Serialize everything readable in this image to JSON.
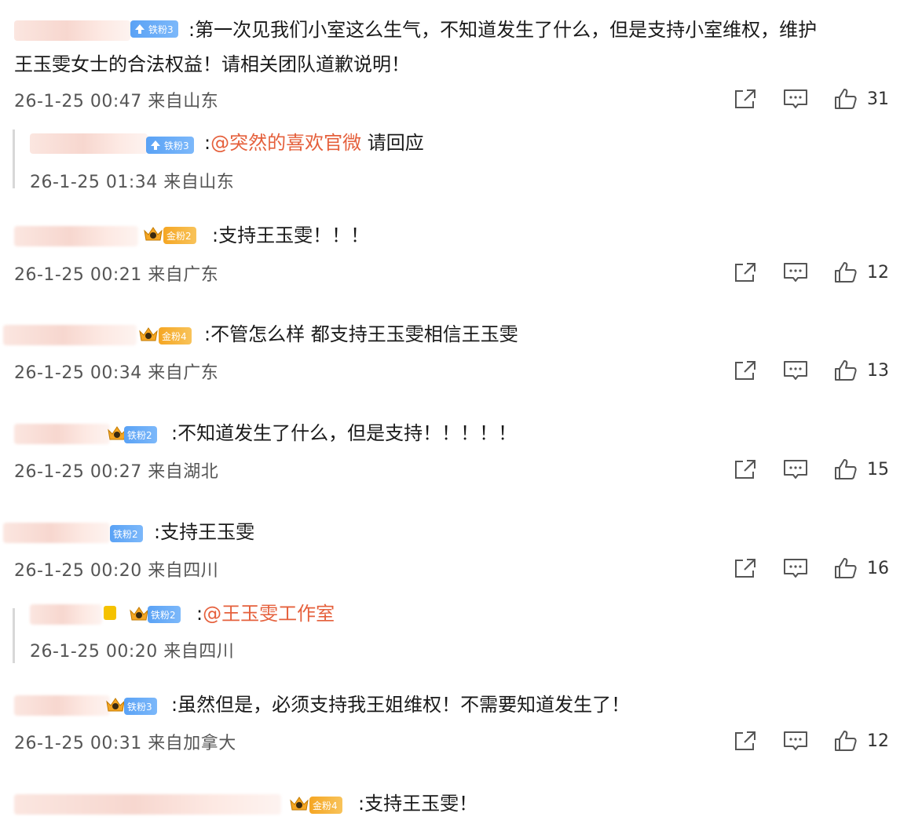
{
  "comments": [
    {
      "badge": "铁粉3",
      "badge_type": "iron",
      "text": ":第一次见我们小室这么生气，不知道发生了什么，但是支持小室维权，维护",
      "text2": "王玉雯女士的合法权益！请相关团队道歉说明！",
      "time": "26-1-25 00:47 来自山东",
      "likes": "31"
    },
    {
      "badge": "铁粉3",
      "badge_type": "iron",
      "text_prefix": ":",
      "mention": "@突然的喜欢官微",
      "text_suffix": " 请回应",
      "time": "26-1-25 01:34 来自山东"
    },
    {
      "badge": "金粉2",
      "badge_type": "gold",
      "text": ":支持王玉雯！！！",
      "time": "26-1-25 00:21 来自广东",
      "likes": "12"
    },
    {
      "badge": "金粉4",
      "badge_type": "gold",
      "text": ":不管怎么样 都支持王玉雯相信王玉雯",
      "time": "26-1-25 00:34 来自广东",
      "likes": "13"
    },
    {
      "badge": "铁粉2",
      "badge_type": "iron",
      "text": ":不知道发生了什么，但是支持！！！！！",
      "time": "26-1-25 00:27 来自湖北",
      "likes": "15"
    },
    {
      "badge": "铁粉2",
      "badge_type": "iron",
      "text": ":支持王玉雯",
      "time": "26-1-25 00:20 来自四川",
      "likes": "16"
    },
    {
      "badge": "铁粉2",
      "badge_type": "iron",
      "text_prefix": ":",
      "mention": "@王玉雯工作室",
      "time": "26-1-25 00:20 来自四川"
    },
    {
      "badge": "铁粉3",
      "badge_type": "iron",
      "text": ":虽然但是，必须支持我王姐维权！不需要知道发生了！",
      "time": "26-1-25 00:31 来自加拿大",
      "likes": "12"
    },
    {
      "badge": "金粉4",
      "badge_type": "gold",
      "text": ":支持王玉雯！"
    }
  ],
  "icons": {
    "share": "share-icon",
    "comment": "comment-icon",
    "like": "like-icon"
  }
}
